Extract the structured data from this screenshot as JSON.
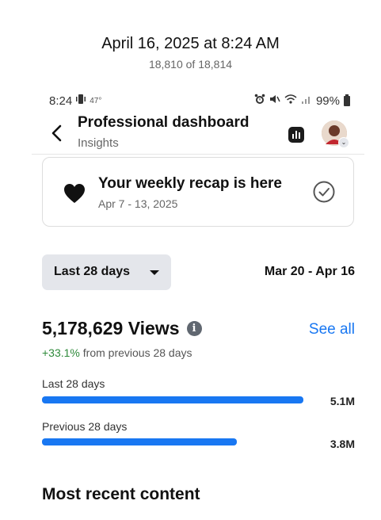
{
  "viewer": {
    "date": "April 16, 2025 at 8:24 AM",
    "count": "18,810 of 18,814"
  },
  "status_bar": {
    "time": "8:24",
    "left_extra": "47°",
    "battery": "99%"
  },
  "header": {
    "title": "Professional dashboard",
    "subtitle": "Insights"
  },
  "recap": {
    "title": "Your weekly recap is here",
    "dates": "Apr 7 - 13, 2025"
  },
  "range": {
    "selected": "Last 28 days",
    "dates": "Mar 20 - Apr 16"
  },
  "views": {
    "count": "5,178,629 Views",
    "see_all": "See all",
    "change_pct": "+33.1%",
    "change_text": " from previous 28 days",
    "bars": [
      {
        "label": "Last 28 days",
        "value": "5.1M",
        "fraction": 1.0
      },
      {
        "label": "Previous 28 days",
        "value": "3.8M",
        "fraction": 0.745
      }
    ]
  },
  "sections": {
    "recent_title": "Most recent content"
  },
  "colors": {
    "accent": "#1877f2",
    "positive": "#2e8a3a"
  },
  "icons": [
    "back-arrow-icon",
    "insights-icon",
    "heart-icon",
    "check-circle-icon",
    "info-icon",
    "caret-down-icon",
    "alarm-icon",
    "wifi-icon",
    "signal-icon",
    "battery-icon"
  ]
}
